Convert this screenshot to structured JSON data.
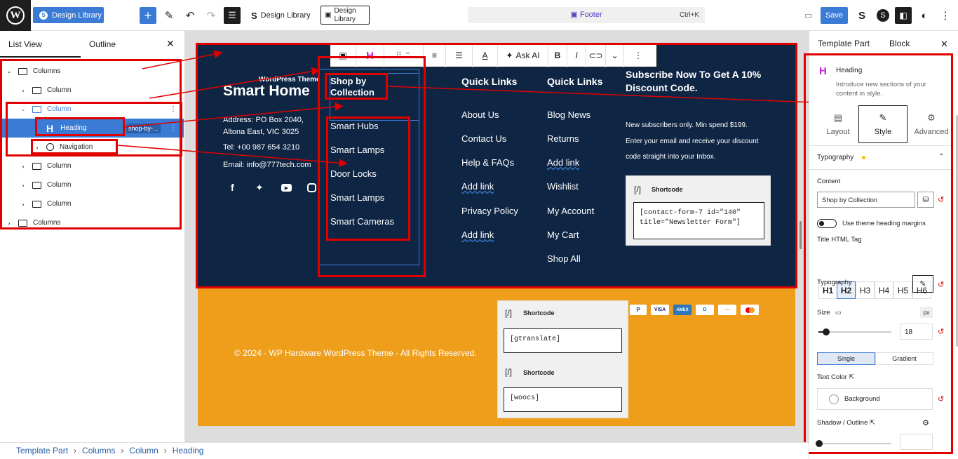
{
  "topbar": {
    "site_label": "Design Library",
    "template_label": "Design Library",
    "template2_line1": "Design",
    "template2_line2": "Library",
    "command": "Footer",
    "shortcut": "Ctrl+K",
    "save_label": "Save"
  },
  "left_panel": {
    "tab_list": "List View",
    "tab_outline": "Outline",
    "tree": [
      {
        "label": "Columns"
      },
      {
        "label": "Column"
      },
      {
        "label": "Column"
      },
      {
        "label": "Heading",
        "badge": "shop-by-..."
      },
      {
        "label": "Navigation"
      },
      {
        "label": "Column"
      },
      {
        "label": "Column"
      },
      {
        "label": "Column"
      },
      {
        "label": "Columns"
      }
    ]
  },
  "footer": {
    "brand_small": "WordPress Theme",
    "brand": "Smart Home",
    "address1": "Address: PO Box 2040,",
    "address2": "Altona East, VIC 3025",
    "tel": "Tel: +00 987 654 3210",
    "email": "Email: info@777tech.com",
    "toolbar": {
      "ask_ai": "Ask AI"
    },
    "col2": {
      "heading_line1": "Shop by",
      "heading_line2": "Collection",
      "links": [
        "Smart Hubs",
        "Smart Lamps",
        "Door Locks",
        "Smart Lamps",
        "Smart Cameras"
      ]
    },
    "col3": {
      "heading": "Quick Links",
      "links": [
        "About Us",
        "Contact Us",
        "Help & FAQs",
        "Add link",
        "Privacy Policy",
        "Add link"
      ]
    },
    "col4": {
      "heading": "Quick Links",
      "links": [
        "Blog News",
        "Returns",
        "Add link",
        "Wishlist",
        "My Account",
        "My Cart",
        "Shop All"
      ]
    },
    "col5": {
      "heading_line1": "Subscribe Now To Get A 10%",
      "heading_line2": "Discount Code.",
      "text1": "New subscribers only. Min spend $199.",
      "text2": "Enter your email and receive your discount",
      "text3": "code straight into your Inbox.",
      "shortcode_label": "Shortcode",
      "code_line1": "[contact-form-7 id=\"140\"",
      "code_line2": "title=\"Newsletter Form\"]"
    },
    "copyright": "© 2024 - WP Hardware WordPress Theme - All Rights Reserved.",
    "shortcode1_label": "Shortcode",
    "shortcode1": "[gtranslate]",
    "shortcode2_label": "Shortcode",
    "shortcode2": "[woocs]",
    "payments": [
      "P",
      "VISA",
      "AMEX",
      "D",
      "—",
      "MC"
    ]
  },
  "right_panel": {
    "tab_template": "Template Part",
    "tab_block": "Block",
    "block_name": "Heading",
    "block_desc1": "Introduce new sections of your",
    "block_desc2": "content in style.",
    "tabs": [
      "Layout",
      "Style",
      "Advanced"
    ],
    "typography_section": "Typography",
    "content_label": "Content",
    "content_value": "Shop by Collection",
    "use_margins": "Use theme heading margins",
    "title_tag_label": "Title HTML Tag",
    "tags": [
      "H1",
      "H2",
      "H3",
      "H4",
      "H5",
      "H6"
    ],
    "active_tag": "H2",
    "typography_label": "Typography",
    "size_label": "Size",
    "size_unit": "px",
    "size_value": "18",
    "fill_single": "Single",
    "fill_gradient": "Gradient",
    "text_color_label": "Text Color",
    "background_label": "Background",
    "shadow_label": "Shadow / Outline"
  },
  "breadcrumb": [
    "Template Part",
    "Columns",
    "Column",
    "Heading"
  ]
}
